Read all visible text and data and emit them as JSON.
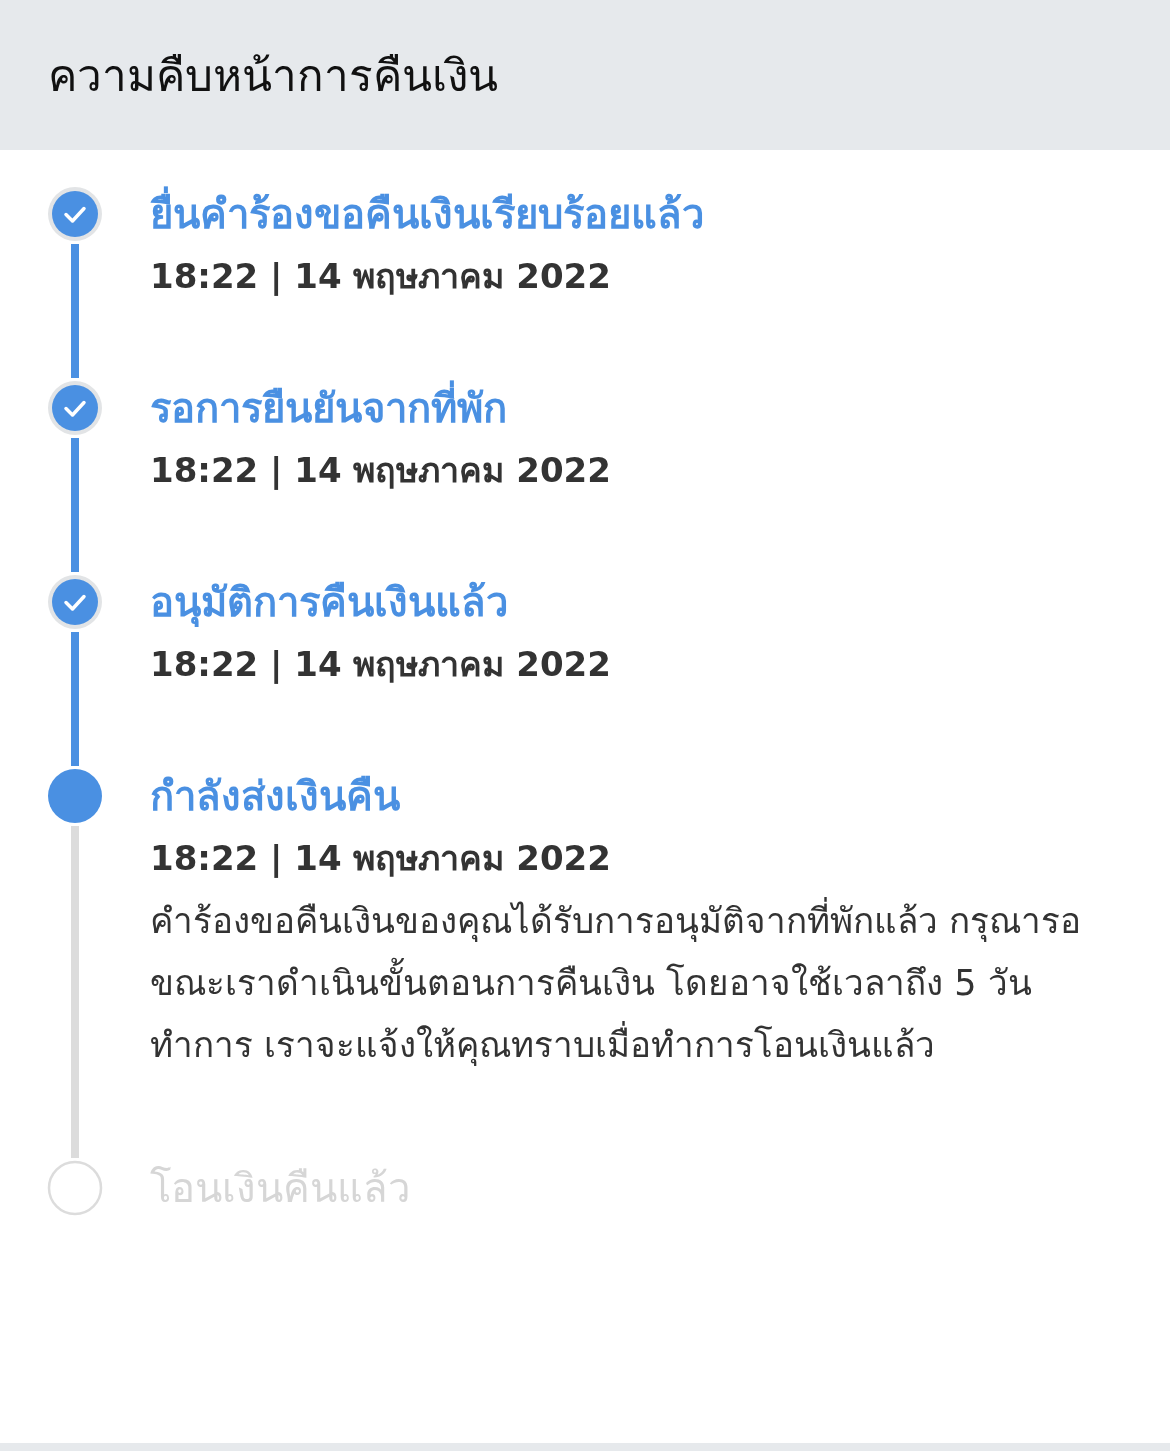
{
  "header": {
    "title": "ความคืบหน้าการคืนเงิน"
  },
  "steps": [
    {
      "kind": "done",
      "title": "ยื่นคำร้องขอคืนเงินเรียบร้อยแล้ว",
      "time": "18:22 | 14 พฤษภาคม 2022"
    },
    {
      "kind": "done",
      "title": "รอการยืนยันจากที่พัก",
      "time": "18:22 | 14 พฤษภาคม 2022"
    },
    {
      "kind": "done",
      "title": "อนุมัติการคืนเงินแล้ว",
      "time": "18:22 | 14 พฤษภาคม 2022"
    },
    {
      "kind": "current",
      "title": "กำลังส่งเงินคืน",
      "time": "18:22 | 14 พฤษภาคม 2022",
      "description": "คำร้องขอคืนเงินของคุณได้รับการอนุมัติจากที่พักแล้ว กรุณารอขณะเราดำเนินขั้นตอนการคืนเงิน โดยอาจใช้เวลาถึง 5 วันทำการ เราจะแจ้งให้คุณทราบเมื่อทำการโอนเงินแล้ว"
    },
    {
      "kind": "pending",
      "title": "โอนเงินคืนแล้ว"
    }
  ]
}
